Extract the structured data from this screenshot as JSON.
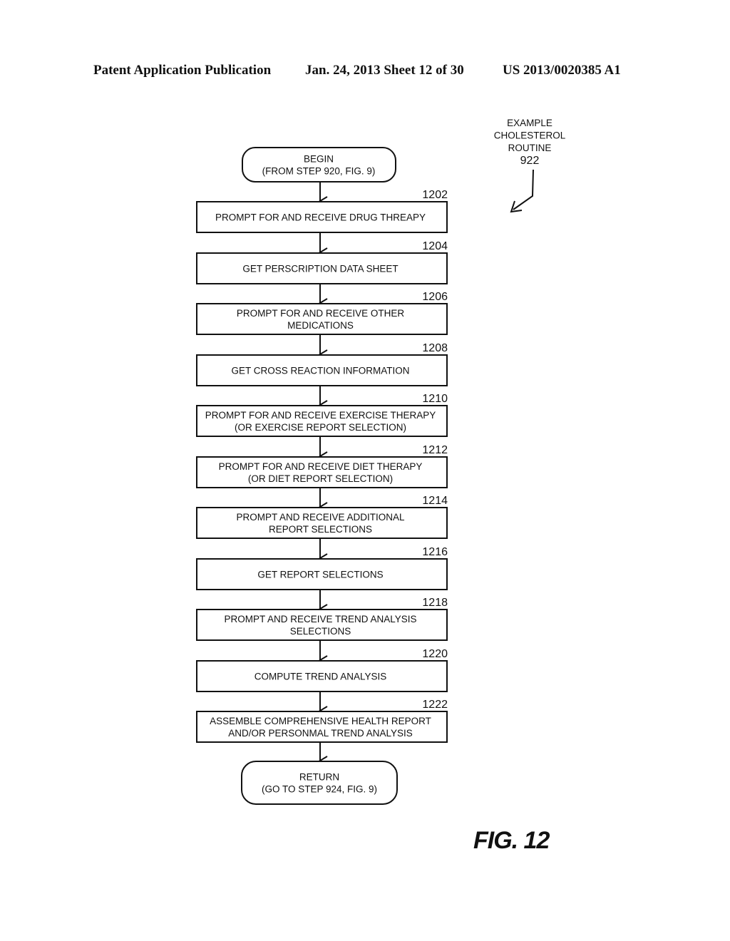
{
  "header": {
    "publication": "Patent Application Publication",
    "date_sheet": "Jan. 24, 2013  Sheet 12 of 30",
    "patent_number": "US 2013/0020385 A1"
  },
  "routine_label": {
    "lines": [
      "EXAMPLE",
      "CHOLESTEROL",
      "ROUTINE"
    ],
    "number": "922"
  },
  "begin": {
    "lines": [
      "BEGIN",
      "(FROM STEP 920, FIG. 9)"
    ]
  },
  "steps": [
    {
      "id": "1202",
      "lines": [
        "PROMPT FOR AND RECEIVE DRUG THREAPY"
      ]
    },
    {
      "id": "1204",
      "lines": [
        "GET PERSCRIPTION DATA SHEET"
      ]
    },
    {
      "id": "1206",
      "lines": [
        "PROMPT FOR AND RECEIVE OTHER",
        "MEDICATIONS"
      ]
    },
    {
      "id": "1208",
      "lines": [
        "GET CROSS REACTION INFORMATION"
      ]
    },
    {
      "id": "1210",
      "lines": [
        "PROMPT FOR AND RECEIVE  EXERCISE  THERAPY",
        "(OR EXERCISE REPORT SELECTION)"
      ]
    },
    {
      "id": "1212",
      "lines": [
        "PROMPT FOR AND RECEIVE  DIET THERAPY",
        "(OR DIET REPORT SELECTION)"
      ]
    },
    {
      "id": "1214",
      "lines": [
        "PROMPT AND RECEIVE  ADDITIONAL",
        "REPORT SELECTIONS"
      ]
    },
    {
      "id": "1216",
      "lines": [
        "GET REPORT SELECTIONS"
      ]
    },
    {
      "id": "1218",
      "lines": [
        "PROMPT AND RECEIVE TREND ANALYSIS",
        "SELECTIONS"
      ]
    },
    {
      "id": "1220",
      "lines": [
        "COMPUTE TREND ANALYSIS"
      ]
    },
    {
      "id": "1222",
      "lines": [
        "ASSEMBLE COMPREHENSIVE HEALTH REPORT",
        "AND/OR PERSONMAL TREND ANALYSIS"
      ]
    }
  ],
  "end": {
    "lines": [
      "RETURN",
      "(GO TO STEP  924, FIG. 9)"
    ]
  },
  "figure_label": "FIG. 12"
}
